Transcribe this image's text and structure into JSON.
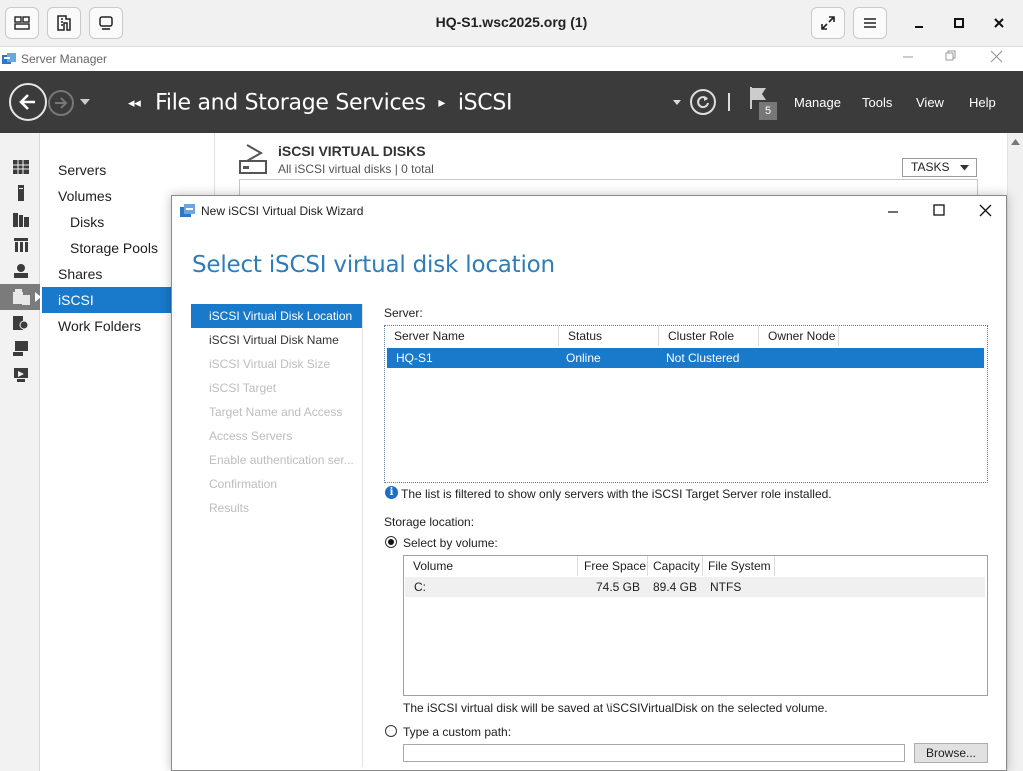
{
  "viewer": {
    "title": "HQ-S1.wsc2025.org (1)"
  },
  "window": {
    "app_title": "Server Manager"
  },
  "header": {
    "breadcrumb_parent": "File and Storage Services",
    "breadcrumb_separator": "▸",
    "breadcrumb_current": "iSCSI",
    "notification_count": "5",
    "menu": {
      "manage": "Manage",
      "tools": "Tools",
      "view": "View",
      "help": "Help"
    }
  },
  "subnav": {
    "items": [
      {
        "label": "Servers"
      },
      {
        "label": "Volumes"
      },
      {
        "label": "Disks"
      },
      {
        "label": "Storage Pools"
      },
      {
        "label": "Shares"
      },
      {
        "label": "iSCSI"
      },
      {
        "label": "Work Folders"
      }
    ]
  },
  "main": {
    "section_title": "iSCSI VIRTUAL DISKS",
    "section_subtitle": "All iSCSI virtual disks | 0 total",
    "tasks_label": "TASKS"
  },
  "dialog": {
    "title": "New iSCSI Virtual Disk Wizard",
    "heading": "Select iSCSI virtual disk location",
    "steps": [
      {
        "label": "iSCSI Virtual Disk Location"
      },
      {
        "label": "iSCSI Virtual Disk Name"
      },
      {
        "label": "iSCSI Virtual Disk Size"
      },
      {
        "label": "iSCSI Target"
      },
      {
        "label": "Target Name and Access"
      },
      {
        "label": "Access Servers"
      },
      {
        "label": "Enable authentication ser..."
      },
      {
        "label": "Confirmation"
      },
      {
        "label": "Results"
      }
    ],
    "server_label": "Server:",
    "server_table": {
      "columns": [
        "Server Name",
        "Status",
        "Cluster Role",
        "Owner Node"
      ],
      "rows": [
        {
          "name": "HQ-S1",
          "status": "Online",
          "cluster_role": "Not Clustered",
          "owner_node": ""
        }
      ]
    },
    "filter_note": "The list is filtered to show only servers with the iSCSI Target Server role installed.",
    "storage_location_label": "Storage location:",
    "select_by_volume_label": "Select by volume:",
    "volume_table": {
      "columns": [
        "Volume",
        "Free Space",
        "Capacity",
        "File System"
      ],
      "rows": [
        {
          "volume": "C:",
          "free_space": "74.5 GB",
          "capacity": "89.4 GB",
          "file_system": "NTFS"
        }
      ]
    },
    "save_note": "The iSCSI virtual disk will be saved at \\iSCSIVirtualDisk on the selected volume.",
    "custom_path_label": "Type a custom path:",
    "custom_path_value": "",
    "browse_label": "Browse..."
  }
}
